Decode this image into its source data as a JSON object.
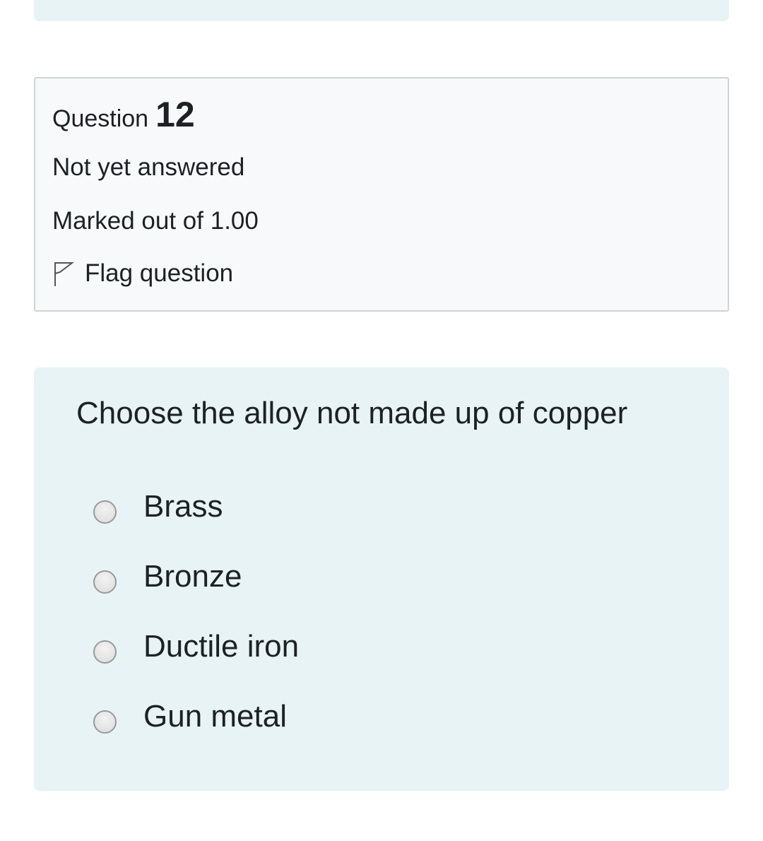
{
  "question_info": {
    "label": "Question",
    "number": "12",
    "state": "Not yet answered",
    "grade": "Marked out of 1.00",
    "flag_label": "Flag question",
    "flag_icon": "flag-outline-icon"
  },
  "question": {
    "text": "Choose the alloy not made up of copper",
    "options": [
      {
        "label": "Brass",
        "selected": false
      },
      {
        "label": "Bronze",
        "selected": false
      },
      {
        "label": "Ductile iron",
        "selected": false
      },
      {
        "label": "Gun metal",
        "selected": false
      }
    ]
  },
  "colors": {
    "content_background": "#e7f3f5",
    "info_background": "#f8f9fa",
    "info_border": "#ced4da",
    "text": "#1d2125"
  }
}
